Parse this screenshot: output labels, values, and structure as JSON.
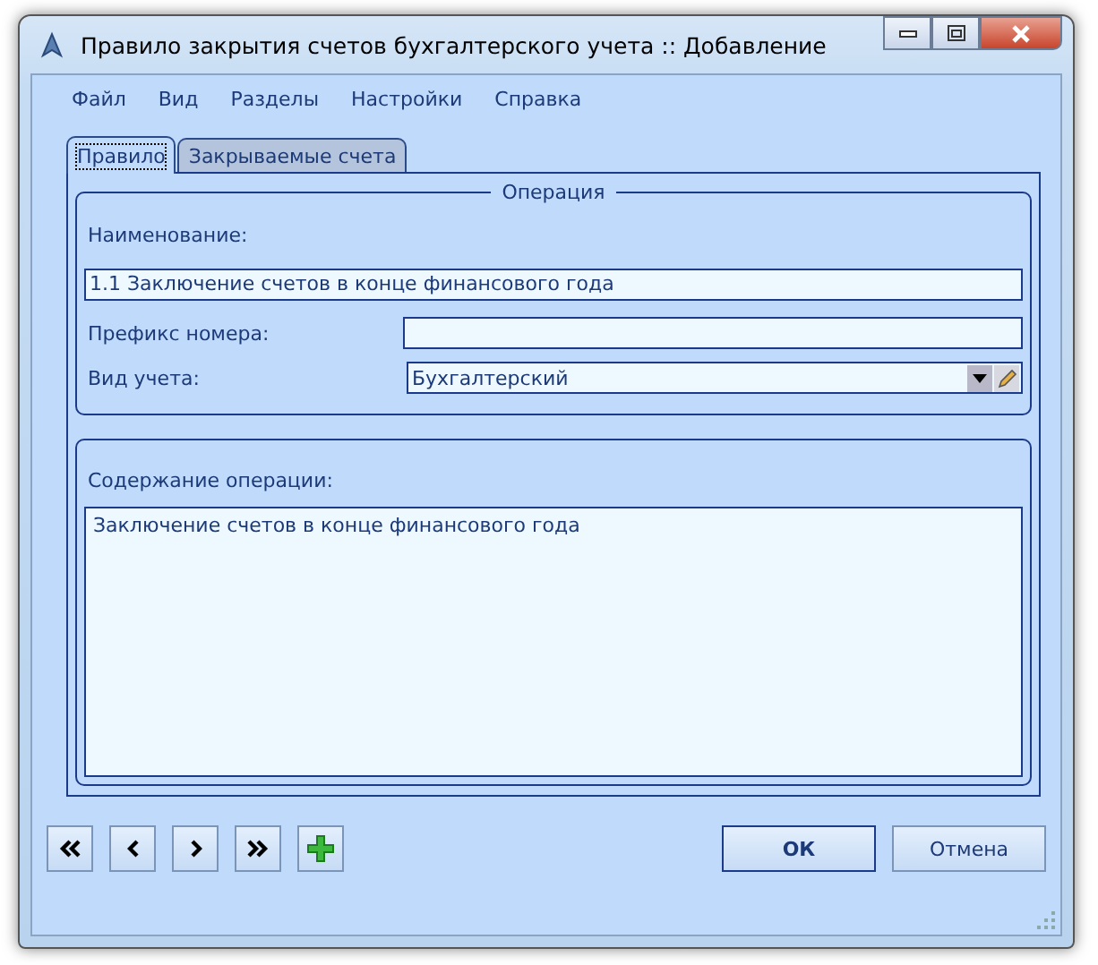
{
  "window": {
    "title": "Правило закрытия счетов бухгалтерского учета :: Добавление"
  },
  "menu": [
    "Файл",
    "Вид",
    "Разделы",
    "Настройки",
    "Справка"
  ],
  "tabs": [
    {
      "label": "Правило",
      "selected": true
    },
    {
      "label": "Закрываемые счета",
      "selected": false
    }
  ],
  "operation": {
    "title": "Операция",
    "name_label": "Наименование:",
    "name_value": "1.1 Заключение счетов в конце финансового года",
    "prefix_label": "Префикс номера:",
    "type_label": "Вид учета:",
    "type_value": "Бухгалтерский"
  },
  "content": {
    "label": "Содержание операции:",
    "value": "Заключение счетов в конце финансового года"
  },
  "buttons": {
    "ok": "ОК",
    "cancel": "Отмена"
  }
}
